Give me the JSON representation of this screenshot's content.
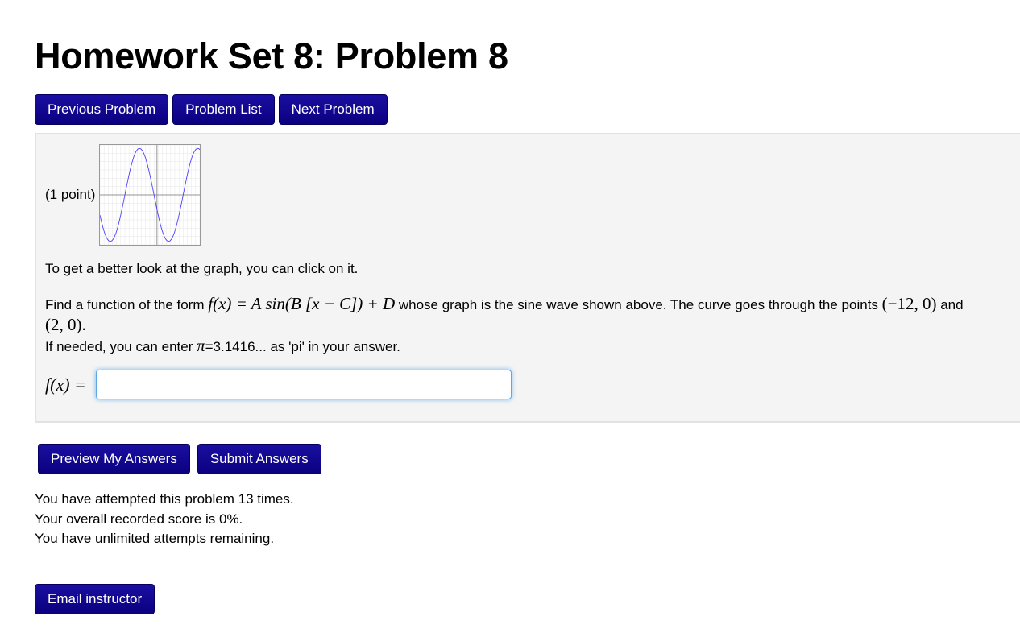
{
  "page": {
    "title": "Homework Set 8: Problem 8"
  },
  "nav": {
    "previous_label": "Previous Problem",
    "list_label": "Problem List",
    "next_label": "Next Problem"
  },
  "problem": {
    "points": "(1 point)",
    "graph_icon": "sine-wave-graph-thumbnail",
    "hint": "To get a better look at the graph, you can click on it.",
    "intro": "Find a function of the form",
    "form_f": "f",
    "form_rest": "(x) = A sin(B [x − C]) + D",
    "middle": " whose graph is the sine wave shown above. The curve goes through the points ",
    "point1": "(−12, 0)",
    "and_text": " and",
    "point2": "(2, 0).",
    "pi_note_prefix": "If needed, you can enter ",
    "pi_symbol": "π",
    "pi_note_suffix": "=3.1416... as 'pi' in your answer.",
    "answer_label": "f(x) =",
    "answer_value": ""
  },
  "graph_data": {
    "x_range": [
      -24,
      24
    ],
    "y_range": [
      -9,
      9
    ],
    "period": 28,
    "zeros": [
      -12,
      2
    ]
  },
  "actions": {
    "preview_label": "Preview My Answers",
    "submit_label": "Submit Answers"
  },
  "status": {
    "attempts": "You have attempted this problem 13 times.",
    "score": "Your overall recorded score is 0%.",
    "remaining": "You have unlimited attempts remaining."
  },
  "footer": {
    "email_label": "Email instructor"
  },
  "colors": {
    "button": "#0b0080",
    "panel_bg": "#f4f4f4",
    "curve": "#4a3cff"
  }
}
